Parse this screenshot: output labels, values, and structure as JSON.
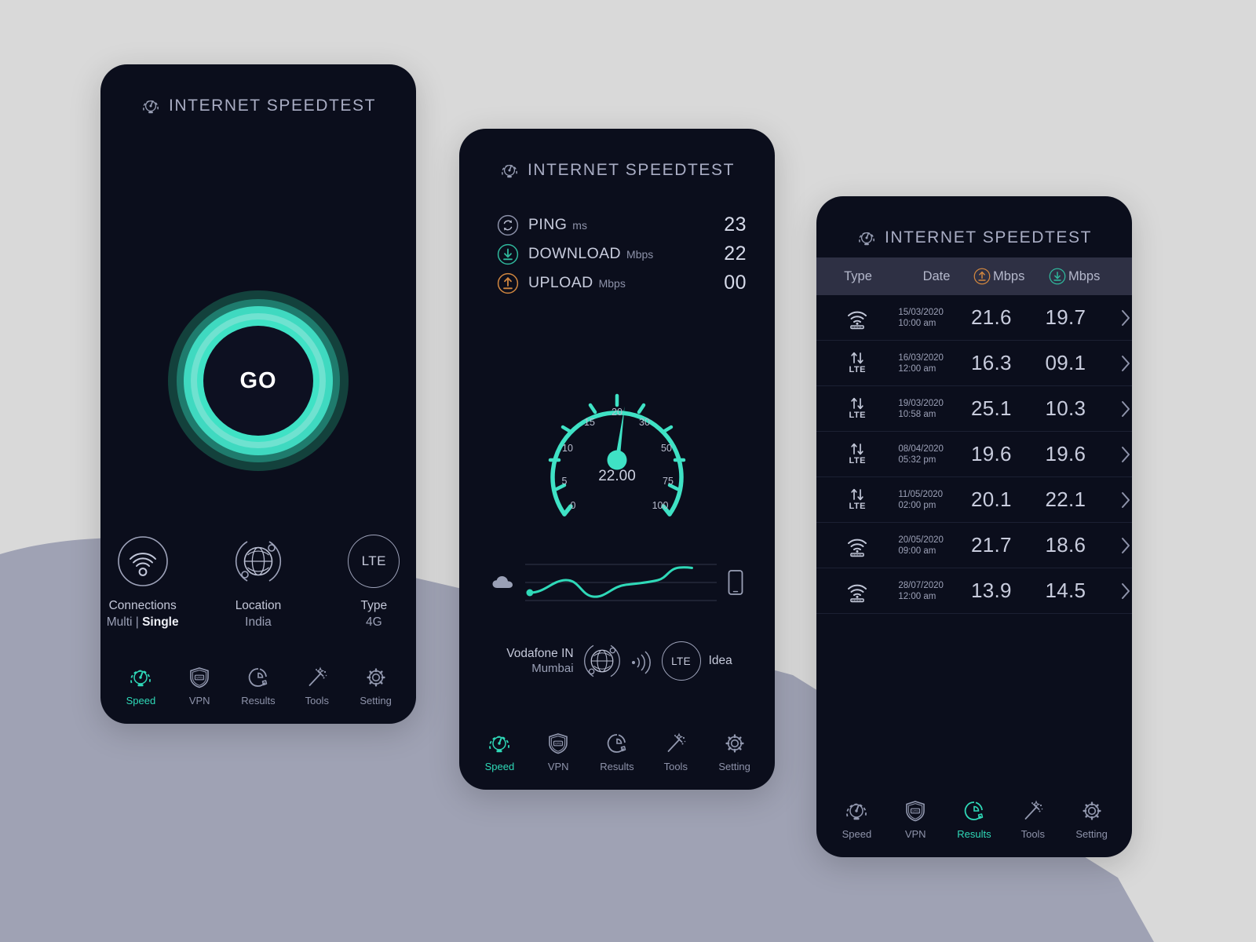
{
  "colors": {
    "page_bg": "#d9d9d9",
    "page_wedge": "#9fa2b4",
    "phone_bg": "#0b0e1c",
    "accent_teal": "#3fd9c0",
    "accent_orange": "#d0863f",
    "text_primary": "#c8ccdd",
    "text_muted": "#9aa0b6",
    "table_header_bg": "#2e3044"
  },
  "app": {
    "title": "INTERNET SPEEDTEST",
    "brand_icon": "speedometer-icon"
  },
  "nav": {
    "items": [
      {
        "label": "Speed",
        "icon": "speedometer-icon"
      },
      {
        "label": "VPN",
        "icon": "shield-vpn-icon"
      },
      {
        "label": "Results",
        "icon": "donut-chart-icon"
      },
      {
        "label": "Tools",
        "icon": "magic-wand-icon"
      },
      {
        "label": "Setting",
        "icon": "gear-icon"
      }
    ],
    "active_speed": "Speed",
    "active_results": "Results"
  },
  "screen1": {
    "go_button_label": "GO",
    "info": [
      {
        "title": "Connections",
        "value_a": "Multi",
        "separator": " | ",
        "value_b": "Single",
        "icon": "wifi-icon"
      },
      {
        "title": "Location",
        "value": "India",
        "icon": "globe-orbit-icon"
      },
      {
        "title": "Type",
        "value": "4G",
        "icon": "lte-badge-icon",
        "badge": "LTE"
      }
    ]
  },
  "screen2": {
    "stats": [
      {
        "name": "PING",
        "unit": "ms",
        "value": "23",
        "icon": "ping-refresh-icon",
        "color": "#9aa0b6"
      },
      {
        "name": "DOWNLOAD",
        "unit": "Mbps",
        "value": "22",
        "icon": "download-arrow-icon",
        "color": "#2fb89c"
      },
      {
        "name": "UPLOAD",
        "unit": "Mbps",
        "value": "00",
        "icon": "upload-arrow-icon",
        "color": "#d0863f"
      }
    ],
    "gauge": {
      "value_text": "22.00",
      "value": 22.0,
      "needle_angle_deg": 8,
      "ticks": [
        "0",
        "5",
        "10",
        "15",
        "20",
        "30",
        "50",
        "75",
        "100"
      ]
    },
    "sparkline": {
      "left_icon": "cloud-icon",
      "right_icon": "smartphone-icon",
      "points": [
        0.45,
        0.62,
        0.7,
        0.52,
        0.38,
        0.48,
        0.62,
        0.66,
        0.74,
        0.9,
        0.92
      ]
    },
    "carrier": {
      "name": "Vodafone IN",
      "city": "Mumbai",
      "globe_icon": "globe-orbit-icon",
      "signal_icon": "signal-waves-icon",
      "network_badge": "LTE",
      "alt_name": "Idea"
    }
  },
  "screen3": {
    "table": {
      "columns": [
        "Type",
        "Date",
        "Mbps",
        "Mbps"
      ],
      "upload_icon": "upload-arrow-icon",
      "download_icon": "download-arrow-icon",
      "rows": [
        {
          "type": "wifi",
          "type_label": "",
          "date": "15/03/2020",
          "time": "10:00 am",
          "up": "21.6",
          "down": "19.7"
        },
        {
          "type": "lte",
          "type_label": "LTE",
          "date": "16/03/2020",
          "time": "12:00 am",
          "up": "16.3",
          "down": "09.1"
        },
        {
          "type": "lte",
          "type_label": "LTE",
          "date": "19/03/2020",
          "time": "10:58 am",
          "up": "25.1",
          "down": "10.3"
        },
        {
          "type": "lte",
          "type_label": "LTE",
          "date": "08/04/2020",
          "time": "05:32 pm",
          "up": "19.6",
          "down": "19.6"
        },
        {
          "type": "lte",
          "type_label": "LTE",
          "date": "11/05/2020",
          "time": "02:00 pm",
          "up": "20.1",
          "down": "22.1"
        },
        {
          "type": "wifi",
          "type_label": "",
          "date": "20/05/2020",
          "time": "09:00 am",
          "up": "21.7",
          "down": "18.6"
        },
        {
          "type": "wifi",
          "type_label": "",
          "date": "28/07/2020",
          "time": "12:00 am",
          "up": "13.9",
          "down": "14.5"
        }
      ]
    }
  }
}
